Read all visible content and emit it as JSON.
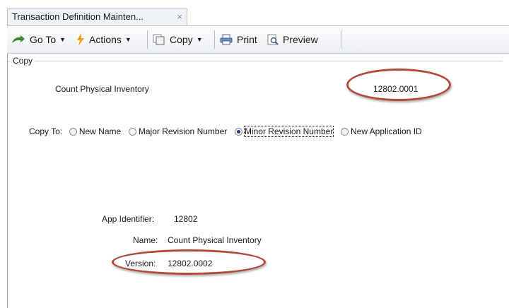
{
  "tab": {
    "title": "Transaction Definition Mainten...",
    "close": "×"
  },
  "toolbar": {
    "goto_label": "Go To",
    "actions_label": "Actions",
    "copy_label": "Copy",
    "print_label": "Print",
    "preview_label": "Preview"
  },
  "copy_group": {
    "label": "Copy",
    "source_name": "Count Physical Inventory",
    "source_version": "12802.0001",
    "copy_to_label": "Copy To:",
    "options": [
      {
        "label": "New Name",
        "selected": false
      },
      {
        "label": "Major Revision Number",
        "selected": false
      },
      {
        "label": "Minor Revision Number",
        "selected": true
      },
      {
        "label": "New Application ID",
        "selected": false
      }
    ]
  },
  "result": {
    "app_identifier_label": "App Identifier:",
    "app_identifier_value": "12802",
    "name_label": "Name:",
    "name_value": "Count Physical Inventory",
    "version_label": "Version:",
    "version_value": "12802.0002"
  },
  "colors": {
    "highlight": "#b24a3a",
    "radio_selected": "#1f3d8a"
  }
}
